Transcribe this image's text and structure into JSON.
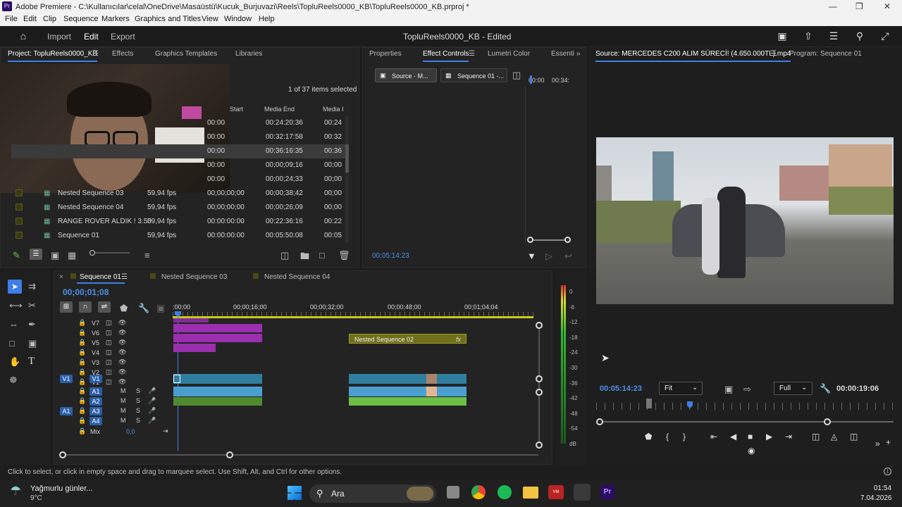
{
  "window": {
    "title": "Adobe Premiere - C:\\Kullanıcılar\\celal\\OneDrive\\Masaüstü\\Kucuk_Burjuvazi\\Reels\\TopluReels0000_KB\\TopluReels0000_KB.prproj *",
    "app_badge": "Pr"
  },
  "menu": [
    "File",
    "Edit",
    "Clip",
    "Sequence",
    "Markers",
    "Graphics and Titles",
    "View",
    "Window",
    "Help"
  ],
  "header": {
    "tabs": [
      "Import",
      "Edit",
      "Export"
    ],
    "active_tab": "Edit",
    "project_title": "TopluReels0000_KB - Edited"
  },
  "project_panel": {
    "tabs": [
      "Project: TopluReels0000_KB",
      "Effects",
      "Graphics Templates",
      "Libraries"
    ],
    "selection_info": "1 of 37 items selected",
    "columns": [
      "Start",
      "Media End",
      "Media I"
    ],
    "rows": [
      {
        "name": "",
        "fps": "",
        "start": "00:00",
        "end": "00:24:20:36",
        "mi": "00:24"
      },
      {
        "name": "",
        "fps": "",
        "start": "00:00",
        "end": "00:32:17:58",
        "mi": "00:32"
      },
      {
        "name": "",
        "fps": "",
        "start": "00:00",
        "end": "00:36:16:35",
        "mi": "00:36"
      },
      {
        "name": "",
        "fps": "",
        "start": "00:00",
        "end": "00;00;09;16",
        "mi": "00;00"
      },
      {
        "name": "",
        "fps": "",
        "start": "00:00",
        "end": "00;00;24;33",
        "mi": "00;00"
      },
      {
        "name": "Nested Sequence 03",
        "fps": "59,94 fps",
        "start": "00;00;00;00",
        "end": "00;00;38;42",
        "mi": "00;00"
      },
      {
        "name": "Nested Sequence 04",
        "fps": "59,94 fps",
        "start": "00;00;00;00",
        "end": "00;00;26;09",
        "mi": "00;00"
      },
      {
        "name": "RANGE ROVER ALDIK ! 3.50",
        "fps": "59,94 fps",
        "start": "00:00:00:00",
        "end": "00:22:36:16",
        "mi": "00:22"
      },
      {
        "name": "Sequence 01",
        "fps": "59,94 fps",
        "start": "00:00:00:00",
        "end": "00:05:50:08",
        "mi": "00:05"
      }
    ]
  },
  "effect_panel": {
    "tabs": [
      "Properties",
      "Effect Controls",
      "Lumetri Color",
      "Essenti"
    ],
    "source_btn": "Source · M...",
    "seq_btn": "Sequence 01 -...",
    "ruler": [
      "00:00",
      "00:34:"
    ],
    "timecode": "00:05:14:23"
  },
  "source_monitor": {
    "tabs": [
      "Source: MERCEDES C200 ALIM SÜRECİ! (4.650.000TL).mp4",
      "Program: Sequence 01"
    ],
    "timecode": "00:05:14:23",
    "fit": "Fit",
    "quality": "Full",
    "duration": "00:00:19:06"
  },
  "timeline": {
    "tabs": [
      "Sequence 01",
      "Nested Sequence 03",
      "Nested Sequence 04"
    ],
    "timecode": "00;00;01;08",
    "ruler": [
      ":00;00",
      "00;00;16;00",
      "00;00;32;00",
      "00;00;48;00",
      "00;01;04;04"
    ],
    "video_tracks": [
      "V7",
      "V6",
      "V5",
      "V4",
      "V3",
      "V2",
      "V1"
    ],
    "audio_tracks": [
      "A1",
      "A2",
      "A3",
      "A4"
    ],
    "mix_label": "Mix",
    "mix_value": "0,0",
    "nested_clip_label": "Nested Sequence 02",
    "fx_badge": "fx",
    "toggle": {
      "v": "V1",
      "a": "A1"
    },
    "ms": [
      "M",
      "S"
    ]
  },
  "vu_scale": [
    "0",
    "-6",
    "-12",
    "-18",
    "-24",
    "-30",
    "-36",
    "-42",
    "-48",
    "-54",
    "dB"
  ],
  "status": "Click to select, or click in empty space and drag to marquee select. Use Shift, Alt, and Ctrl for other options.",
  "taskbar": {
    "weather": "Yağmurlu günler...",
    "temp": "9°C",
    "search": "Ara",
    "time": "01:54",
    "date": "7.04.2026"
  }
}
